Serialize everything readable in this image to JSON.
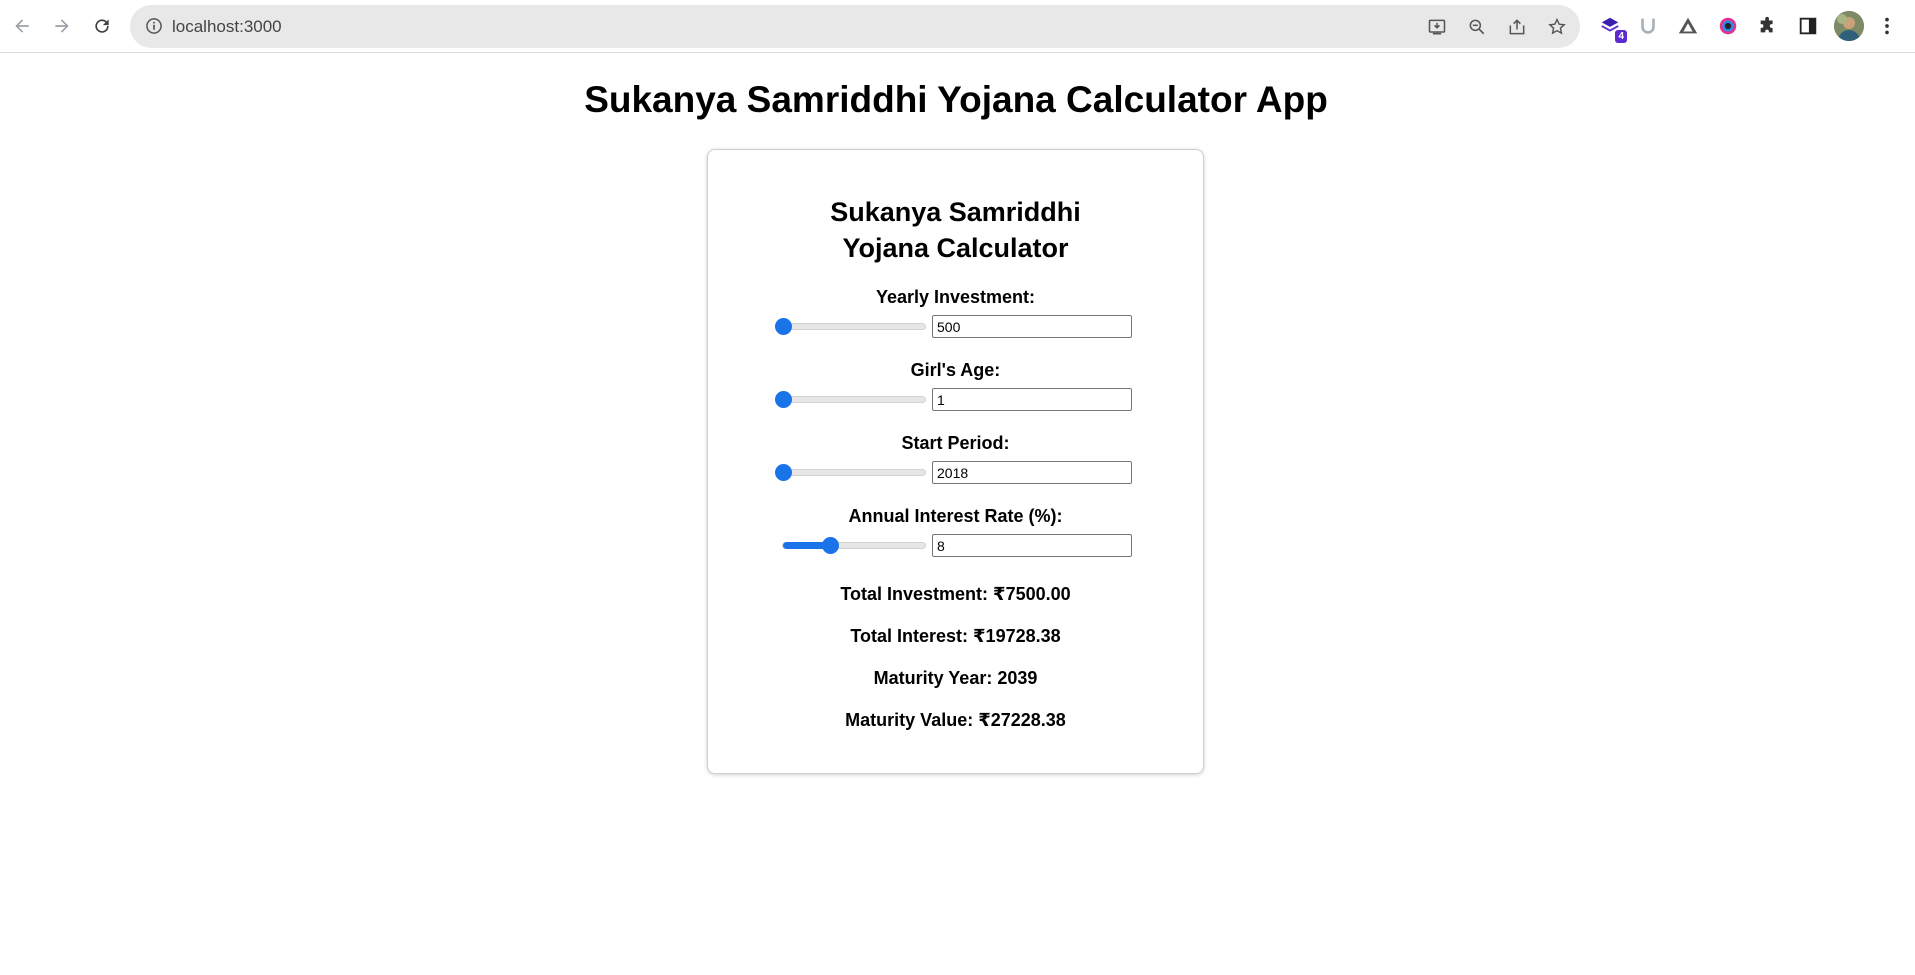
{
  "browser": {
    "url": "localhost:3000",
    "extension_badge": "4"
  },
  "page": {
    "title": "Sukanya Samriddhi Yojana Calculator App"
  },
  "calculator": {
    "title": "Sukanya Samriddhi Yojana Calculator",
    "accent_color": "#1a73e8",
    "fields": [
      {
        "label": "Yearly Investment:",
        "value": "500",
        "slider_fraction": 0.0
      },
      {
        "label": "Girl's Age:",
        "value": "1",
        "slider_fraction": 0.0
      },
      {
        "label": "Start Period:",
        "value": "2018",
        "slider_fraction": 0.0
      },
      {
        "label": "Annual Interest Rate (%):",
        "value": "8",
        "slider_fraction": 0.33
      }
    ],
    "results": {
      "total_investment": "Total Investment: ₹7500.00",
      "total_interest": "Total Interest: ₹19728.38",
      "maturity_year": "Maturity Year: 2039",
      "maturity_value": "Maturity Value: ₹27228.38"
    }
  }
}
